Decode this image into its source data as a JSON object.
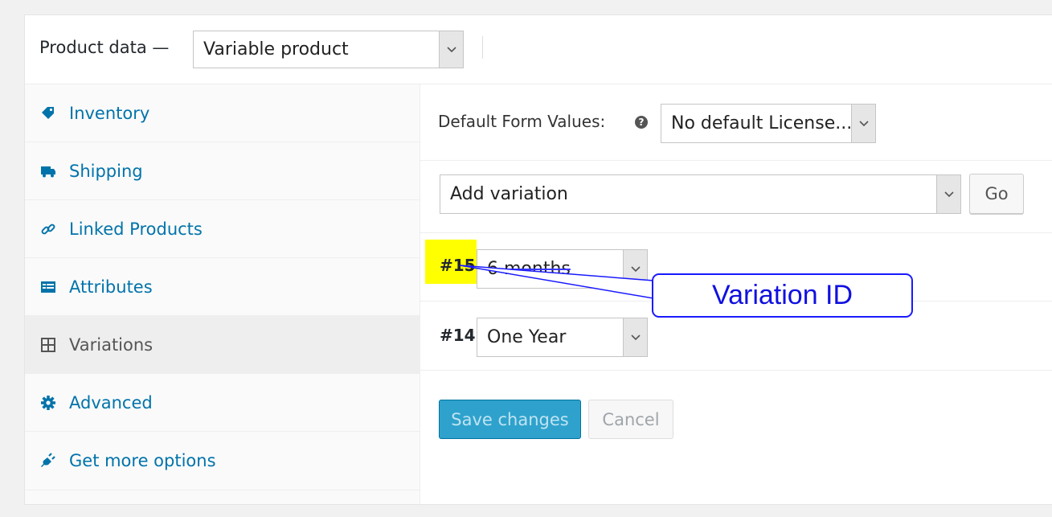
{
  "header": {
    "title": "Product data —",
    "product_type": "Variable product"
  },
  "sidebar": {
    "items": [
      {
        "label": "Inventory",
        "icon": "tag-icon"
      },
      {
        "label": "Shipping",
        "icon": "truck-icon"
      },
      {
        "label": "Linked Products",
        "icon": "link-icon"
      },
      {
        "label": "Attributes",
        "icon": "list-icon"
      },
      {
        "label": "Variations",
        "icon": "grid-icon",
        "active": true
      },
      {
        "label": "Advanced",
        "icon": "gear-icon"
      },
      {
        "label": "Get more options",
        "icon": "plugin-icon"
      }
    ]
  },
  "content": {
    "default_form_label": "Default Form Values:",
    "help_glyph": "?",
    "default_form_value": "No default License...",
    "add_variation": "Add variation",
    "go_label": "Go",
    "variations": [
      {
        "id": "#15",
        "value": "6 months"
      },
      {
        "id": "#14",
        "value": "One Year"
      }
    ],
    "save_label": "Save changes",
    "cancel_label": "Cancel"
  },
  "annotation": {
    "label": "Variation ID"
  },
  "colors": {
    "link": "#0073aa",
    "primary_button": "#2ea2cc",
    "highlight": "#ffff00",
    "annotation": "#1a1aff"
  }
}
